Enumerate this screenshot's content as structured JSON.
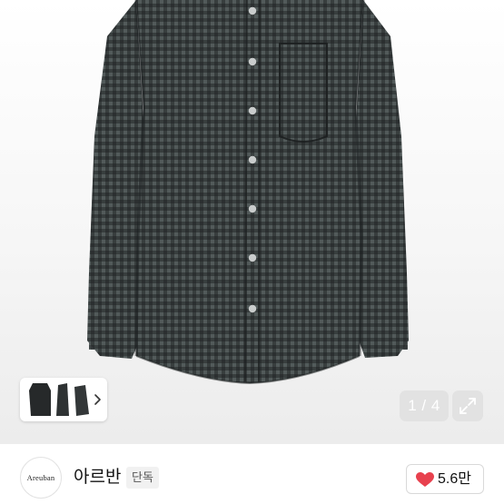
{
  "product": {
    "image_alt": "black gingham check shirt",
    "pagination": {
      "current": "1",
      "separator": "/",
      "total": "4",
      "label": "1 / 4"
    }
  },
  "gallery": {
    "thumbnail_count": 3
  },
  "brand": {
    "logo_text": "Areuban",
    "name": "아르반",
    "badge": "단독"
  },
  "likes": {
    "count": "5.6만"
  },
  "icons": {
    "expand": "expand-icon",
    "chevron": "chevron-right-icon",
    "heart": "heart-icon"
  },
  "colors": {
    "heart": "#e8414e",
    "shirt": "#2a2d2e",
    "check": "#4a5252"
  }
}
